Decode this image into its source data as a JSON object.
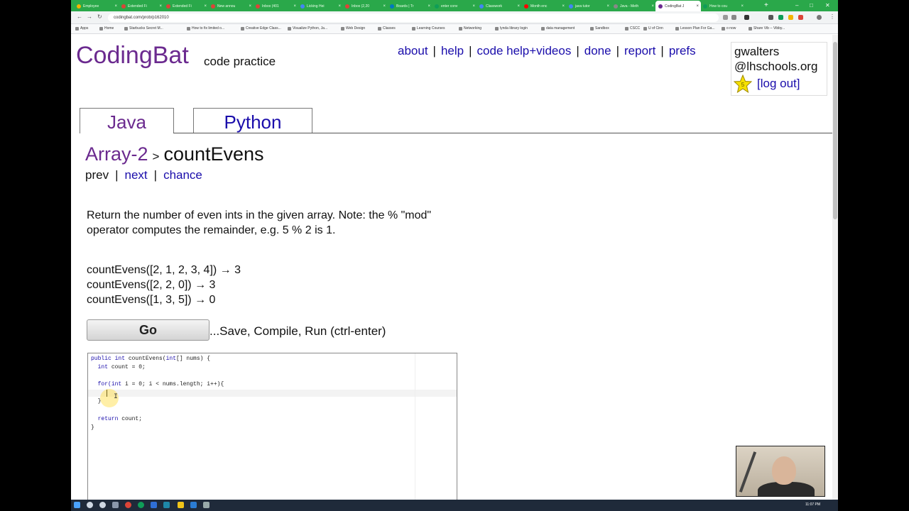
{
  "browser": {
    "tabs": [
      {
        "label": "Employee",
        "color": "#f4b400"
      },
      {
        "label": "Extended Fi",
        "color": "#db4437"
      },
      {
        "label": "Extended Fi",
        "color": "#db4437"
      },
      {
        "label": "New annou",
        "color": "#db4437"
      },
      {
        "label": "Inbox (401",
        "color": "#db4437"
      },
      {
        "label": "Licking Hei",
        "color": "#4285f4"
      },
      {
        "label": "Inbox (2,20",
        "color": "#db4437"
      },
      {
        "label": "Boards | Tr",
        "color": "#0079bf"
      },
      {
        "label": "enter conv",
        "color": "#0f9d58"
      },
      {
        "label": "Classwork",
        "color": "#4285f4"
      },
      {
        "label": "Month enc",
        "color": "#ff0000"
      },
      {
        "label": "java tutor",
        "color": "#4285f4"
      },
      {
        "label": "Java - Meth",
        "color": "#888888"
      },
      {
        "label": "CodingBat J",
        "color": "#6b2a8f"
      },
      {
        "label": "How to cou",
        "color": "#0f9d58"
      }
    ],
    "active_tab_index": 13,
    "url": "codingbat.com/prob/p162010",
    "bookmarks": [
      "Apps",
      "Home",
      "Starbucks Secret M...",
      "How to fix limited o...",
      "Creative Edge Class...",
      "Visualize Python, Ja...",
      "Web Design",
      "Classes",
      "Learning Courses",
      "Networking",
      "lynda library login",
      "data management",
      "Sandbox",
      "CSCC",
      "U of Cinn",
      "Lesson Plan For Ga...",
      "o now",
      "Share Vib -- Vibby..."
    ]
  },
  "site": {
    "logo": "CodingBat",
    "logo_sub": "code practice",
    "nav": [
      "about",
      "help",
      "code help+videos",
      "done",
      "report",
      "prefs"
    ],
    "nav_sep": "|",
    "user": "gwalters",
    "email": "@lhschools.org",
    "star_count": "5",
    "logout": "[log out]"
  },
  "lang_tabs": [
    "Java",
    "Python"
  ],
  "problem": {
    "section": "Array-2",
    "crumb_sep": ">",
    "name": "countEvens",
    "prev": "prev",
    "next": "next",
    "chance": "chance",
    "sep": "|",
    "description": "Return the number of even ints in the given array. Note: the % \"mod\" operator computes the remainder, e.g. 5 % 2 is 1.",
    "examples": [
      "countEvens([2, 1, 2, 3, 4]) → 3",
      "countEvens([2, 2, 0]) → 3",
      "countEvens([1, 3, 5]) → 0"
    ],
    "go": "Go",
    "go_hint": "...Save, Compile, Run (ctrl-enter)"
  },
  "code": {
    "l1a": "public int",
    "l1b": " countEvens(",
    "l1c": "int",
    "l1d": "[] nums) {",
    "l2a": "  int",
    "l2b": " count = 0;",
    "l4a": "  for(",
    "l4b": "int",
    "l4c": " i = 0; i < nums.length; i++){",
    "l6": "  }",
    "l8a": "  return",
    "l8b": " count;",
    "l9": "}"
  },
  "taskbar": {
    "clock": "11:07 PM"
  }
}
